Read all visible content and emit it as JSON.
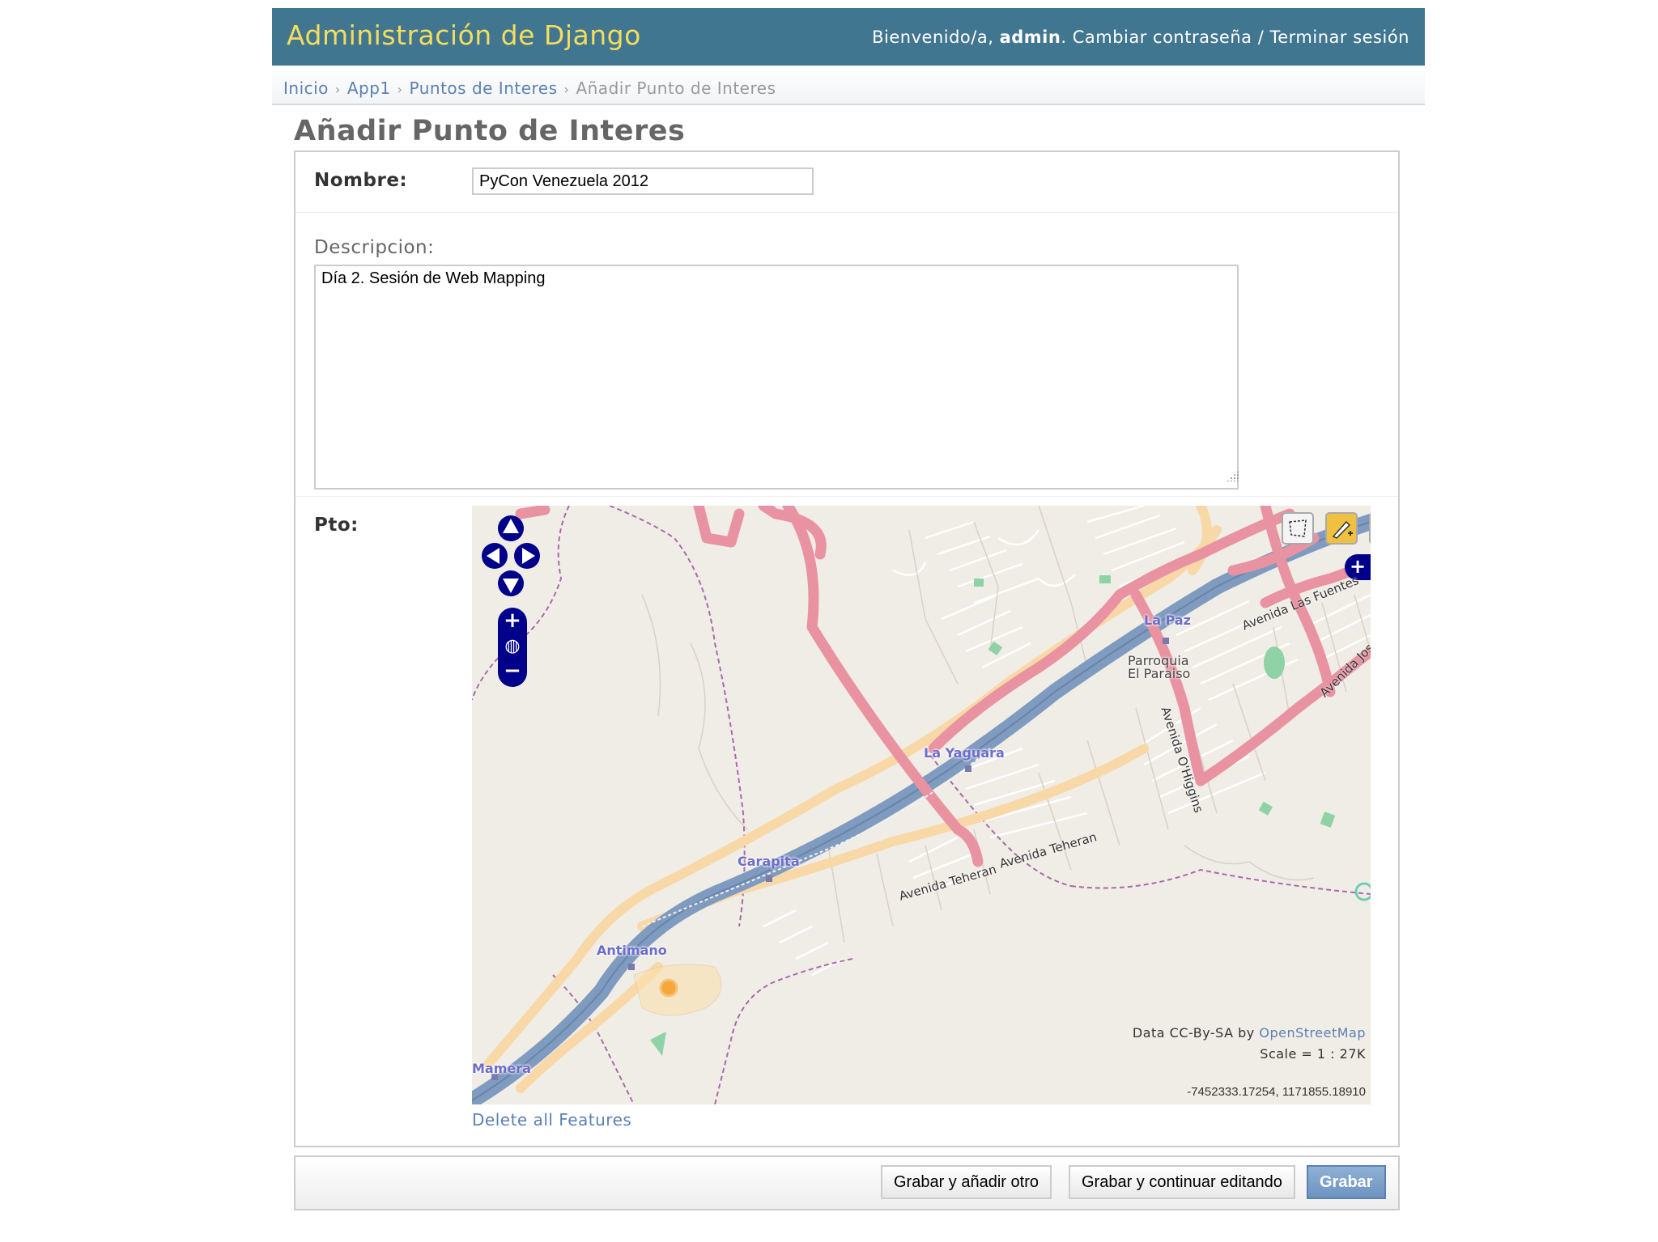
{
  "header": {
    "site_title": "Administración de Django",
    "welcome": "Bienvenido/a,",
    "username": "admin",
    "change_password": "Cambiar contraseña",
    "separator": "/",
    "logout": "Terminar sesión"
  },
  "breadcrumbs": {
    "home": "Inicio",
    "app": "App1",
    "model": "Puntos de Interes",
    "current": "Añadir Punto de Interes",
    "separator": "›"
  },
  "page": {
    "title": "Añadir Punto de Interes"
  },
  "form": {
    "nombre": {
      "label": "Nombre:",
      "value": "PyCon Venezuela 2012"
    },
    "descripcion": {
      "label": "Descripcion:",
      "value": "Día 2. Sesión de Web Mapping"
    },
    "pto": {
      "label": "Pto:"
    }
  },
  "map": {
    "places": {
      "la_paz": "La Paz",
      "parroquia_line1": "Parroquia",
      "parroquia_line2": "El Paraiso",
      "la_yaguara": "La Yaguara",
      "carapita": "Carapita",
      "antimano": "Antimano",
      "mamera": "Mamera"
    },
    "streets": {
      "avenida_las_fuentes": "Avenida Las Fuentes",
      "avenida_jose": "Avenida Jos",
      "avenida_ohiggins": "Avenida O'Higgins",
      "avenida_teheran_1": "Avenida Teheran",
      "avenida_teheran_2": "Avenida Teheran"
    },
    "attribution_prefix": "Data CC-By-SA by",
    "attribution_link": "OpenStreetMap",
    "scale": "Scale = 1 : 27K",
    "coordinates": "-7452333.17254, 1171855.18910",
    "controls": {
      "zoom_in": "+",
      "zoom_out": "−",
      "layer_switcher": "+"
    },
    "colors": {
      "background": "#f0ede6",
      "motorway": "#809bc0",
      "primary": "#e892a2",
      "secondary": "#f9d8a8",
      "boundary": "#a86ba8",
      "control": "#00008b"
    }
  },
  "links": {
    "delete_all_features": "Delete all Features"
  },
  "buttons": {
    "save_add_another": "Grabar y añadir otro",
    "save_continue": "Grabar y continuar editando",
    "save": "Grabar"
  }
}
